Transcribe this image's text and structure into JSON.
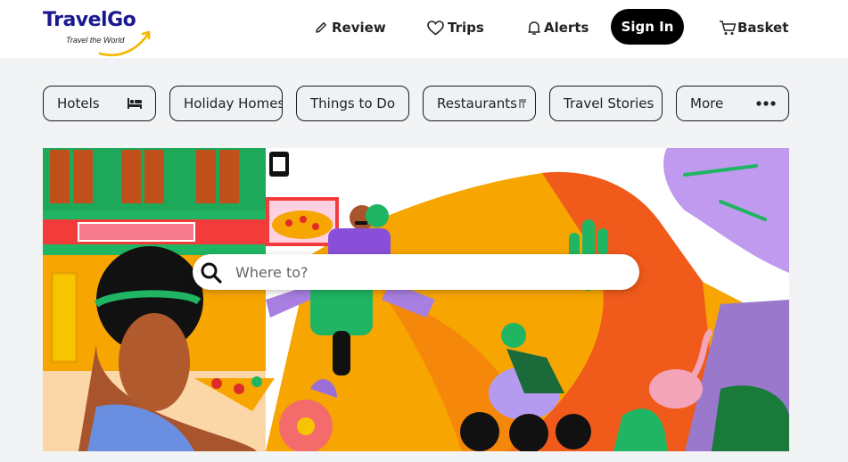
{
  "brand": {
    "name": "TravelGo",
    "tagline": "Travel the World",
    "color": "#1a1890",
    "swoosh_color": "#f5b800"
  },
  "nav": {
    "review": {
      "label": "Review",
      "icon": "pencil-icon"
    },
    "trips": {
      "label": "Trips",
      "icon": "heart-icon"
    },
    "alerts": {
      "label": "Alerts",
      "icon": "bell-icon"
    },
    "signin": {
      "label": "Sign In"
    },
    "basket": {
      "label": "Basket",
      "icon": "cart-icon"
    }
  },
  "categories": [
    {
      "label": "Hotels",
      "icon": "bed-icon"
    },
    {
      "label": "Holiday Homes",
      "icon": ""
    },
    {
      "label": "Things to Do",
      "icon": ""
    },
    {
      "label": "Restaurants",
      "icon": "cutlery-icon"
    },
    {
      "label": "Travel Stories",
      "icon": ""
    },
    {
      "label": "More",
      "icon": "ellipsis-icon"
    }
  ],
  "search": {
    "placeholder": "Where to?",
    "value": "",
    "icon": "search-icon"
  },
  "hero": {
    "illustration": "travel-illustration",
    "sky_color": "#f7a500",
    "accent_orange": "#f05a1a",
    "accent_green": "#1fb562",
    "accent_purple": "#9c6fd6"
  }
}
